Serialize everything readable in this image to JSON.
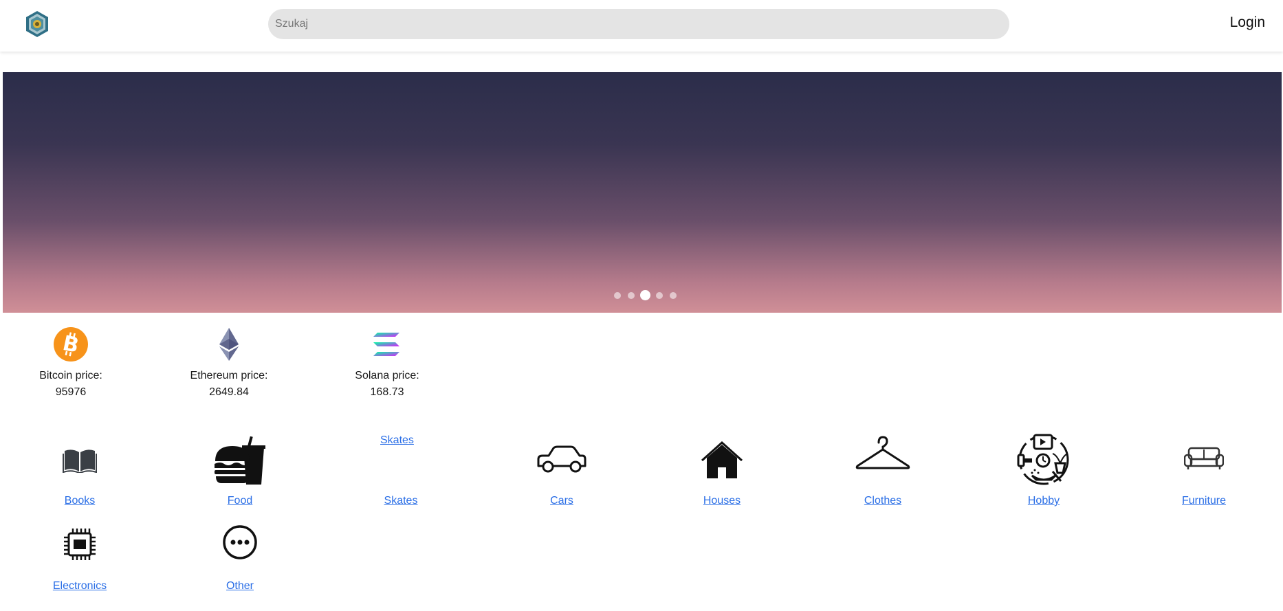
{
  "header": {
    "search_placeholder": "Szukaj",
    "login_label": "Login"
  },
  "hero": {
    "slide_count": 5,
    "active_slide": 3
  },
  "crypto": [
    {
      "label": "Bitcoin price:",
      "value": "95976",
      "icon": "bitcoin-icon"
    },
    {
      "label": "Ethereum price:",
      "value": "2649.84",
      "icon": "ethereum-icon"
    },
    {
      "label": "Solana price:",
      "value": "168.73",
      "icon": "solana-icon"
    }
  ],
  "categories": [
    {
      "label": "Books",
      "icon": "book-icon"
    },
    {
      "label": "Food",
      "icon": "burger-drink-icon"
    },
    {
      "label": "Skates",
      "icon": "broken-image",
      "alt": "Skates"
    },
    {
      "label": "Cars",
      "icon": "car-icon"
    },
    {
      "label": "Houses",
      "icon": "house-icon"
    },
    {
      "label": "Clothes",
      "icon": "hanger-icon"
    },
    {
      "label": "Hobby",
      "icon": "hobby-icon"
    },
    {
      "label": "Furniture",
      "icon": "sofa-icon"
    },
    {
      "label": "Electronics",
      "icon": "chip-icon"
    },
    {
      "label": "Other",
      "icon": "more-icon"
    }
  ],
  "colors": {
    "link": "#2a6ee6",
    "search_bg": "#e4e4e4",
    "bitcoin": "#f7931a"
  }
}
